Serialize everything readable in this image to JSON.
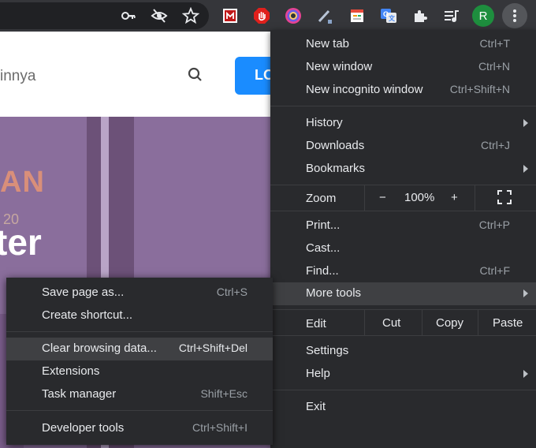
{
  "toolbar": {
    "icons": [
      "key-icon",
      "eye-off-icon",
      "bookmark-star-icon",
      "mcafee-extension-icon",
      "adblock-extension-icon",
      "color-extension-icon",
      "pen-extension-icon",
      "notes-extension-icon",
      "translate-extension-icon",
      "extensions-puzzle-icon",
      "reading-list-icon"
    ],
    "avatar_letter": "R",
    "menu_icon": "three-dots-vertical-icon"
  },
  "page": {
    "search_text": "innya",
    "login_label": "LO",
    "hero_big_text": "ter",
    "hero_small_text": "AN",
    "hero_tiny_text": "20"
  },
  "main_menu": {
    "new_tab": {
      "label": "New tab",
      "shortcut": "Ctrl+T"
    },
    "new_window": {
      "label": "New window",
      "shortcut": "Ctrl+N"
    },
    "new_incognito": {
      "label": "New incognito window",
      "shortcut": "Ctrl+Shift+N"
    },
    "history": {
      "label": "History"
    },
    "downloads": {
      "label": "Downloads",
      "shortcut": "Ctrl+J"
    },
    "bookmarks": {
      "label": "Bookmarks"
    },
    "zoom": {
      "label": "Zoom",
      "minus": "−",
      "value": "100%",
      "plus": "+"
    },
    "print": {
      "label": "Print...",
      "shortcut": "Ctrl+P"
    },
    "cast": {
      "label": "Cast..."
    },
    "find": {
      "label": "Find...",
      "shortcut": "Ctrl+F"
    },
    "more_tools": {
      "label": "More tools"
    },
    "edit": {
      "label": "Edit",
      "cut": "Cut",
      "copy": "Copy",
      "paste": "Paste"
    },
    "settings": {
      "label": "Settings"
    },
    "help": {
      "label": "Help"
    },
    "exit": {
      "label": "Exit"
    }
  },
  "sub_menu": {
    "save_page": {
      "label": "Save page as...",
      "shortcut": "Ctrl+S"
    },
    "create_shortcut": {
      "label": "Create shortcut..."
    },
    "clear_data": {
      "label": "Clear browsing data...",
      "shortcut": "Ctrl+Shift+Del"
    },
    "extensions": {
      "label": "Extensions"
    },
    "task_manager": {
      "label": "Task manager",
      "shortcut": "Shift+Esc"
    },
    "developer_tools": {
      "label": "Developer tools",
      "shortcut": "Ctrl+Shift+I"
    }
  },
  "colors": {
    "menu_bg": "#292a2d",
    "highlight": "#3f4043",
    "text": "#e8eaed",
    "shortcut": "#9aa0a6",
    "login_blue": "#1a8cff",
    "avatar_green": "#1e8e3e"
  }
}
